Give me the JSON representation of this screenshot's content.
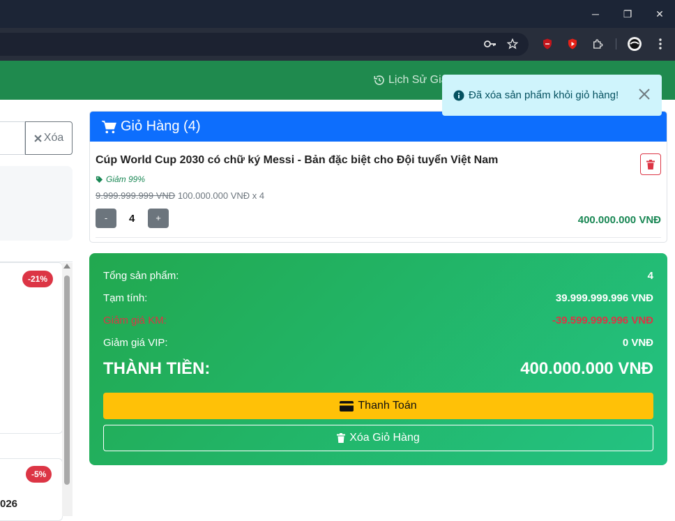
{
  "browser": {
    "window_controls": {
      "minimize": "─",
      "restore": "❐",
      "close": "✕"
    }
  },
  "nav": {
    "history_label": "Lịch Sử Gia"
  },
  "search": {
    "clear_label": "Xóa"
  },
  "products": {
    "badges": [
      "-21%",
      "-5%"
    ],
    "partial_text": "026"
  },
  "cart": {
    "title": "Giỏ Hàng (4)",
    "item": {
      "name": "Cúp World Cup 2030 có chữ ký Messi - Bản đặc biệt cho Đội tuyển Việt Nam",
      "promo": "Giảm 99%",
      "old_price": "9.999.999.999 VNĐ",
      "price_line": "100.000.000 VNĐ x 4",
      "qty_minus": "-",
      "qty_plus": "+",
      "quantity": "4",
      "total": "400.000.000 VNĐ"
    }
  },
  "summary": {
    "rows": [
      {
        "label": "Tổng sản phẩm:",
        "value": "4"
      },
      {
        "label": "Tạm tính:",
        "value": "39.999.999.996 VNĐ"
      },
      {
        "label": "Giảm giá KM:",
        "value": "-39.599.999.996 VNĐ"
      },
      {
        "label": "Giảm giá VIP:",
        "value": "0 VNĐ"
      }
    ],
    "total_label": "THÀNH TIỀN:",
    "total_value": "400.000.000 VNĐ",
    "pay_label": "Thanh Toán",
    "clear_label": "Xóa Giỏ Hàng"
  },
  "toast": {
    "message": "Đã xóa sản phẩm khỏi giỏ hàng!"
  },
  "colors": {
    "navbar": "#1f8a4e",
    "cart_header": "#0d6efd",
    "summary_gradient": [
      "#22a84f",
      "#23c383"
    ],
    "pay_button": "#ffc107",
    "danger": "#dc3545",
    "success_text": "#198754",
    "toast_bg": "#cff4fc"
  }
}
